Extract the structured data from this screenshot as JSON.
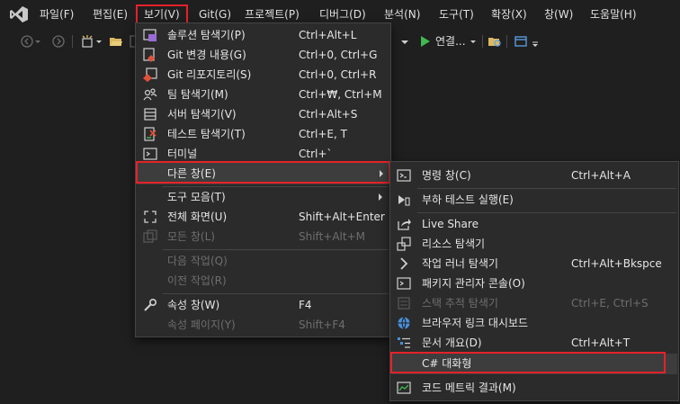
{
  "menubar": {
    "items": [
      "파일(F)",
      "편집(E)",
      "보기(V)",
      "Git(G)",
      "프로젝트(P)",
      "디버그(D)",
      "분석(N)",
      "도구(T)",
      "확장(X)",
      "창(W)",
      "도움말(H)"
    ]
  },
  "toolbar": {
    "connect_label": "연결..."
  },
  "view_menu": {
    "items": [
      {
        "icon": "solution-explorer-icon",
        "label": "솔루션 탐색기(P)",
        "shortcut": "Ctrl+Alt+L"
      },
      {
        "icon": "git-changes-icon",
        "label": "Git 변경 내용(G)",
        "shortcut": "Ctrl+0, Ctrl+G"
      },
      {
        "icon": "git-repository-icon",
        "label": "Git 리포지토리(S)",
        "shortcut": "Ctrl+0, Ctrl+R"
      },
      {
        "icon": "team-explorer-icon",
        "label": "팀 탐색기(M)",
        "shortcut": "Ctrl+₩, Ctrl+M"
      },
      {
        "icon": "server-explorer-icon",
        "label": "서버 탐색기(V)",
        "shortcut": "Ctrl+Alt+S"
      },
      {
        "icon": "test-explorer-icon",
        "label": "테스트 탐색기(T)",
        "shortcut": "Ctrl+E, T"
      },
      {
        "icon": "terminal-icon",
        "label": "터미널",
        "shortcut": "Ctrl+`"
      },
      {
        "icon": "",
        "label": "다른 창(E)",
        "shortcut": ""
      },
      {
        "icon": "",
        "label": "도구 모음(T)",
        "shortcut": ""
      },
      {
        "icon": "full-screen-icon",
        "label": "전체 화면(U)",
        "shortcut": "Shift+Alt+Enter"
      },
      {
        "icon": "all-windows-icon",
        "label": "모든 창(L)",
        "shortcut": "Shift+Alt+M"
      },
      {
        "icon": "",
        "label": "다음 작업(Q)",
        "shortcut": ""
      },
      {
        "icon": "",
        "label": "이전 작업(R)",
        "shortcut": ""
      },
      {
        "icon": "properties-icon",
        "label": "속성 창(W)",
        "shortcut": "F4"
      },
      {
        "icon": "",
        "label": "속성 페이지(Y)",
        "shortcut": "Shift+F4"
      }
    ]
  },
  "other_windows_menu": {
    "items": [
      {
        "icon": "command-window-icon",
        "label": "명령 창(C)",
        "shortcut": "Ctrl+Alt+A"
      },
      {
        "icon": "load-test-icon",
        "label": "부하 테스트 실행(E)",
        "shortcut": ""
      },
      {
        "icon": "live-share-icon",
        "label": "Live Share",
        "shortcut": ""
      },
      {
        "icon": "resource-explorer-icon",
        "label": "리소스 탐색기",
        "shortcut": ""
      },
      {
        "icon": "task-runner-icon",
        "label": "작업 러너 탐색기",
        "shortcut": "Ctrl+Alt+Bkspce"
      },
      {
        "icon": "package-console-icon",
        "label": "패키지 관리자 콘솔(O)",
        "shortcut": ""
      },
      {
        "icon": "stack-trace-icon",
        "label": "스택 추적 탐색기",
        "shortcut": "Ctrl+E, Ctrl+S"
      },
      {
        "icon": "browser-link-icon",
        "label": "브라우저 링크 대시보드",
        "shortcut": ""
      },
      {
        "icon": "document-outline-icon",
        "label": "문서 개요(D)",
        "shortcut": "Ctrl+Alt+T"
      },
      {
        "icon": "",
        "label": "C# 대화형",
        "shortcut": ""
      },
      {
        "icon": "code-metrics-icon",
        "label": "코드 메트릭 결과(M)",
        "shortcut": ""
      }
    ]
  },
  "colors": {
    "background": "#1f1f1f",
    "menu_background": "#2b2b2b",
    "highlight": "#3d3d3d",
    "annotation_red": "#e5222a",
    "accent_purple": "#9b6bd6",
    "git_red": "#e0513a",
    "run_green": "#3fb950",
    "folder_yellow": "#dcb862"
  }
}
